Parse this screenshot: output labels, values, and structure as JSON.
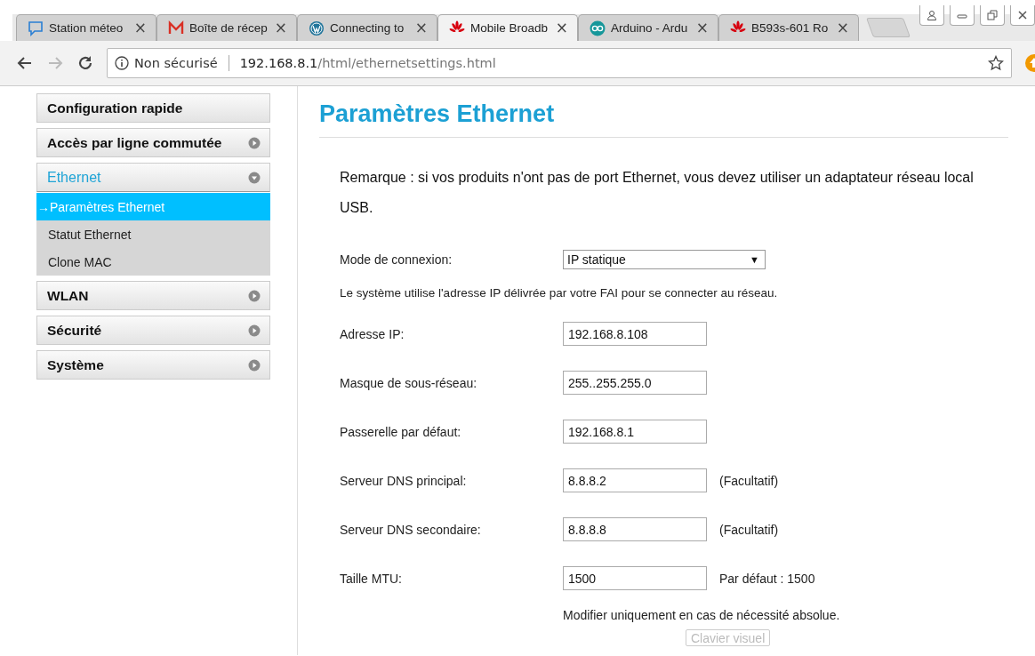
{
  "browser": {
    "tabs": [
      {
        "title": "Station méteo",
        "kind": "chat",
        "selected": false
      },
      {
        "title": "Boîte de récep",
        "kind": "mail",
        "selected": false
      },
      {
        "title": "Connecting to",
        "kind": "wordpress",
        "selected": false
      },
      {
        "title": "Mobile Broadb",
        "kind": "flower",
        "selected": true
      },
      {
        "title": "Arduino - Ardu",
        "kind": "infinity",
        "selected": false
      },
      {
        "title": "B593s-601 Ro",
        "kind": "flower",
        "selected": false
      }
    ],
    "close_glyph": "×",
    "address": {
      "security": "Non sécurisé",
      "host": "192.168.8.1",
      "path": "/html/ethernetsettings.html"
    }
  },
  "sidebar": {
    "items": [
      {
        "label": "Configuration rapide",
        "kind": "link",
        "selected": false
      },
      {
        "label": "Accès par ligne commutée",
        "kind": "group",
        "expanded": false,
        "selected": false
      },
      {
        "label": "Ethernet",
        "kind": "group",
        "expanded": true,
        "selected": true,
        "children": [
          {
            "label": "Paramètres Ethernet",
            "selected": true
          },
          {
            "label": "Statut Ethernet",
            "selected": false
          },
          {
            "label": "Clone MAC",
            "selected": false
          }
        ]
      },
      {
        "label": "WLAN",
        "kind": "group",
        "expanded": false,
        "selected": false
      },
      {
        "label": "Sécurité",
        "kind": "group",
        "expanded": false,
        "selected": false
      },
      {
        "label": "Système",
        "kind": "group",
        "expanded": false,
        "selected": false
      }
    ],
    "child_marker": "→"
  },
  "page": {
    "title": "Paramètres Ethernet",
    "remark": "Remarque : si vos produits n'ont pas de port Ethernet, vous devez utiliser un adaptateur réseau local USB.",
    "rows": [
      {
        "kind": "select",
        "label": "Mode de connexion:",
        "value": "IP statique",
        "caret": "▼"
      },
      {
        "kind": "note",
        "text": "Le système utilise l'adresse IP délivrée par votre FAI pour se connecter au réseau."
      },
      {
        "kind": "input",
        "label": "Adresse IP:",
        "value": "192.168.8.108"
      },
      {
        "kind": "input",
        "label": "Masque de sous-réseau:",
        "value": "255..255.255.0"
      },
      {
        "kind": "input",
        "label": "Passerelle par défaut:",
        "value": "192.168.8.1"
      },
      {
        "kind": "input",
        "label": "Serveur DNS principal:",
        "value": "8.8.8.2",
        "hint": "(Facultatif)"
      },
      {
        "kind": "input",
        "label": "Serveur DNS secondaire:",
        "value": "8.8.8.8",
        "hint": "(Facultatif)"
      },
      {
        "kind": "input",
        "label": "Taille MTU:",
        "value": "1500",
        "hint": "Par défaut : 1500"
      }
    ],
    "footnote": "Modifier uniquement en cas de nécessité absolue.",
    "keyboard_button": {
      "label": "Clavier visuel",
      "disabled": true
    }
  }
}
